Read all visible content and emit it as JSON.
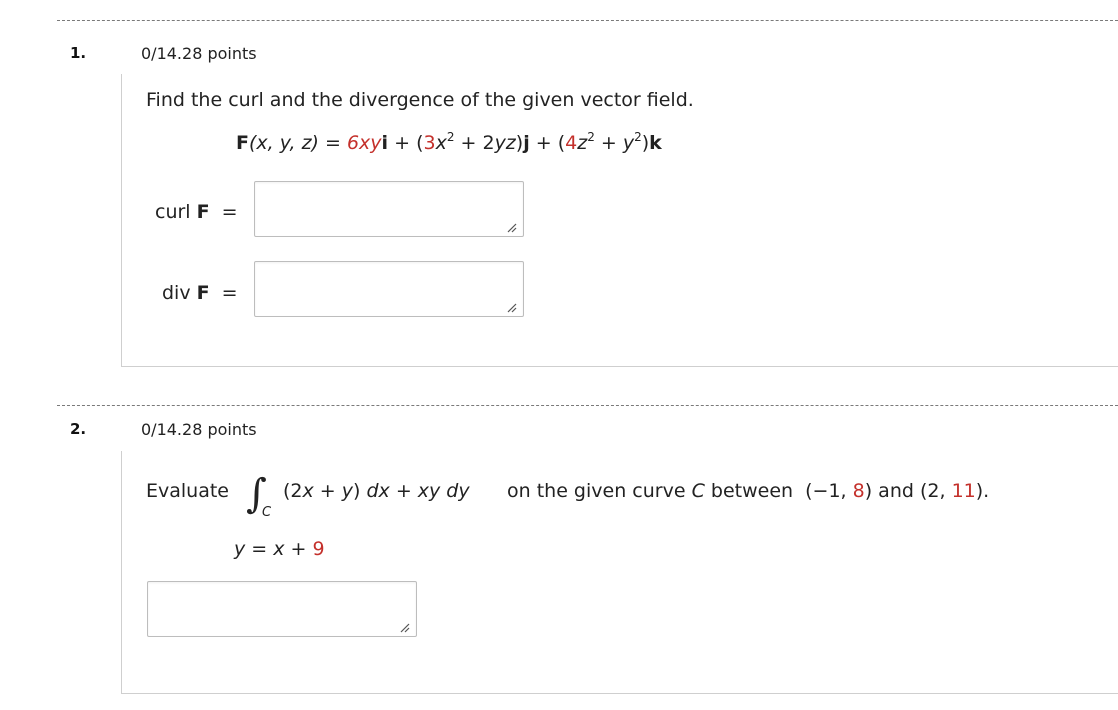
{
  "q1": {
    "number": "1.",
    "points": "0/14.28 points",
    "prompt": "Find the curl and the divergence of the given vector field.",
    "field": {
      "F": "F",
      "args": "(x, y, z)",
      "eq": " = ",
      "t1": "6xy",
      "i": "i",
      "plus": " + ",
      "open": "(",
      "c3": "3",
      "x": "x",
      "exp2": "2",
      "rest1": " + 2",
      "yz": "yz",
      "close": ")",
      "j": "j",
      "c4": "4",
      "z": "z",
      "rest2": " + ",
      "y": "y",
      "k": "k"
    },
    "curl_label": "curl",
    "div_label": "div",
    "F_bold": "F",
    "equals": "=",
    "curl_value": "",
    "div_value": ""
  },
  "q2": {
    "number": "2.",
    "points": "0/14.28 points",
    "evaluate": "Evaluate",
    "integral_symbol": "∫",
    "integral_sub": "C",
    "integrand_pre": "(2",
    "integrand_mid": " + ",
    "integrand_close": ") ",
    "dx": "dx",
    "xy_dy": "xy dy",
    "curve_text": "on the given curve",
    "C": "C",
    "between": "between",
    "p1_pre": "(−1, ",
    "p1_red": "8",
    "p1_post": ")",
    "and": "and",
    "p2_pre": "(2, ",
    "p2_red": "11",
    "p2_post": ").",
    "curve_y": "y",
    "curve_eq": " = ",
    "curve_x": "x",
    "curve_plus": " + ",
    "curve_const": "9",
    "answer_value": ""
  },
  "colors": {
    "accent_red": "#c4302b",
    "divider": "#7a7a7a",
    "panel_border": "#cfcfcf"
  }
}
